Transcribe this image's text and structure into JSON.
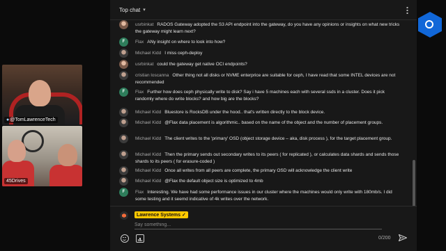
{
  "chat": {
    "header_title": "Top chat",
    "messages": [
      {
        "author": "usrbinkat",
        "text": "RADOS Gateway adopted the S3 API endpoint into the gateway, do you have any opinions or insights on what new tricks the gateway might learn next?",
        "avatar": "photo"
      },
      {
        "author": "Flax",
        "text": "ANy insight on where to look into how?",
        "avatar": "F"
      },
      {
        "author": "Michael Kidd",
        "text": "I miss ceph-deploy",
        "avatar": "photo-dark"
      },
      {
        "author": "usrbinkat",
        "text": "could the gateway get native OCI endpoints?",
        "avatar": "photo"
      },
      {
        "author": "cristian loscanna",
        "text": "Other thing not all disks or NVME enterprice are suitable for ceph, I have read that some INTEL devices are not recommended",
        "avatar": "photo-dark"
      },
      {
        "author": "Flax",
        "text": "Further how does ceph physically write to disk? Say i have 5 machines each with several ssds in a cluster. Does it pick randomly where do write blocks? and how big are the blocks?",
        "avatar": "F"
      },
      {
        "author": "Michael Kidd",
        "text": "Bluestore is RocksDB under the hood.. that's written directly to the block device.",
        "avatar": "photo-dark"
      },
      {
        "author": "Michael Kidd",
        "text": "@Flax data placement is algorithmic.. based on the name of the object and the number of placement groups.",
        "avatar": "photo-dark"
      },
      {
        "author": "Michael Kidd",
        "text": "The client writes to the 'primary' OSD (object storage device – aka, disk process ), for the target placement group.",
        "avatar": "photo-dark"
      },
      {
        "author": "Michael Kidd",
        "text": "Then the primary sends out secondary writes to its peers ( for replicated ), or calculates data shards and sends those shards to its peers ( for erasure-coded )",
        "avatar": "photo-dark"
      },
      {
        "author": "Michael Kidd",
        "text": "Once all writes from all peers are complete, the primary OSD will acknowledge the client write",
        "avatar": "photo-dark"
      },
      {
        "author": "Michael Kidd",
        "text": "@Flax the default object size is optimized to 4mb",
        "avatar": "photo-dark"
      },
      {
        "author": "Flax",
        "text": "Interesting. We have had some performance issues in our cluster where the machines would only write with 180mb/s. I did some testing and it seemd indicative of 4k writes over the network.",
        "avatar": "F"
      }
    ],
    "input": {
      "user_name": "Lawrence Systems",
      "verified_icon": "check-icon",
      "placeholder": "Say something...",
      "value": "",
      "counter": "0/200"
    }
  },
  "video": {
    "cam1_label": "@TomLawrenceTech",
    "cam2_label": "45Drives"
  },
  "colors": {
    "accent_badge": "#ffc800",
    "flax_avatar": "#2e7d5b",
    "brand": "#1167d8"
  }
}
